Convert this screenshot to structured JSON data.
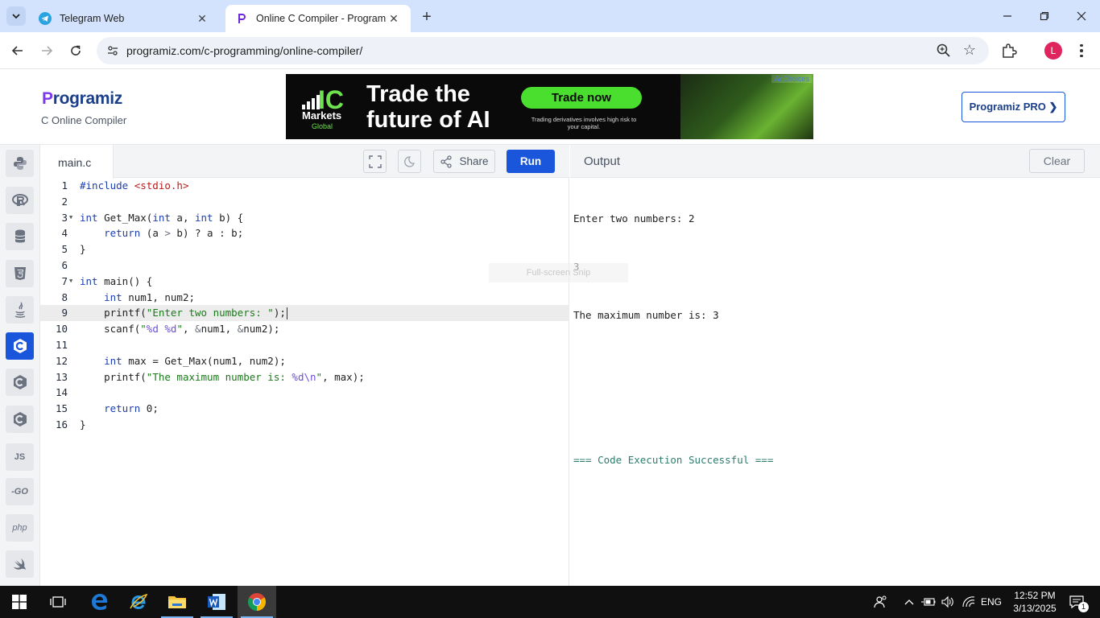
{
  "browser": {
    "tabs": [
      {
        "title": "Telegram Web",
        "active": false
      },
      {
        "title": "Online C Compiler - Programiz",
        "active": true
      }
    ],
    "url": "programiz.com/c-programming/online-compiler/",
    "profile_initial": "L"
  },
  "header": {
    "logo_text": "rogramiz",
    "logo_letter": "P",
    "subtitle": "C Online Compiler",
    "pro_button": "Programiz PRO ❯"
  },
  "ad": {
    "brand_ic": "IC",
    "brand_markets": "Markets",
    "brand_global": "Global",
    "headline_1": "Trade the",
    "headline_2": "future of AI",
    "cta": "Trade now",
    "disclaimer": "Trading derivatives involves high risk to your capital.",
    "adchoices": "AdChoices"
  },
  "rail": {
    "items": [
      {
        "icon": "python-icon"
      },
      {
        "icon": "r-icon"
      },
      {
        "icon": "sql-icon"
      },
      {
        "icon": "html5-icon"
      },
      {
        "icon": "java-icon"
      },
      {
        "icon": "c-icon",
        "active": true
      },
      {
        "icon": "cpp-icon"
      },
      {
        "icon": "csharp-icon"
      },
      {
        "icon": "js-icon",
        "label": "JS"
      },
      {
        "icon": "go-icon",
        "label": "-GO"
      },
      {
        "icon": "php-icon",
        "label": "php"
      },
      {
        "icon": "swift-icon"
      }
    ]
  },
  "editor": {
    "file_name": "main.c",
    "share_label": "Share",
    "run_label": "Run",
    "current_line": 9,
    "lines": [
      "1",
      "2",
      "3",
      "4",
      "5",
      "6",
      "7",
      "8",
      "9",
      "10",
      "11",
      "12",
      "13",
      "14",
      "15",
      "16"
    ],
    "code": {
      "l1_directive": "#include ",
      "l1_header": "<stdio.h>",
      "l3_int": "int",
      "l3_rest1": " Get_Max(",
      "l3_int2": "int",
      "l3_rest2": " a, ",
      "l3_int3": "int",
      "l3_rest3": " b) {",
      "l4_indent": "    ",
      "l4_return": "return",
      "l4_rest1": " (a ",
      "l4_gt": ">",
      "l4_rest2": " b) ? a : b;",
      "l5": "}",
      "l7_int": "int",
      "l7_rest": " main() {",
      "l8_indent": "    ",
      "l8_int": "int",
      "l8_rest": " num1, num2;",
      "l9_indent": "    printf(",
      "l9_str": "\"Enter two numbers: \"",
      "l9_rest": ");",
      "l10_indent": "    scanf(",
      "l10_q1": "\"",
      "l10_fmt": "%d %d",
      "l10_q2": "\"",
      "l10_c1": ", ",
      "l10_amp1": "&",
      "l10_v1": "num1, ",
      "l10_amp2": "&",
      "l10_v2": "num2);",
      "l12_indent": "    ",
      "l12_int": "int",
      "l12_rest": " max = Get_Max(num1, num2);",
      "l13_indent": "    printf(",
      "l13_str": "\"The maximum number is: ",
      "l13_fmt": "%d\\n",
      "l13_q": "\"",
      "l13_rest": ", max);",
      "l15_indent": "    ",
      "l15_return": "return",
      "l15_rest": " 0;",
      "l16": "}"
    }
  },
  "output": {
    "title": "Output",
    "clear_label": "Clear",
    "lines": [
      "Enter two numbers: 2",
      "3",
      "The maximum number is: 3",
      "",
      "",
      "=== Code Execution Successful ==="
    ],
    "overlay_text": "Full-screen Snip"
  },
  "taskbar": {
    "language": "ENG",
    "time": "12:52 PM",
    "date": "3/13/2025",
    "notification_count": "1"
  },
  "colors": {
    "accent": "#1a56db",
    "tabbar": "#d3e3fd",
    "ad_green": "#4ade2f"
  }
}
